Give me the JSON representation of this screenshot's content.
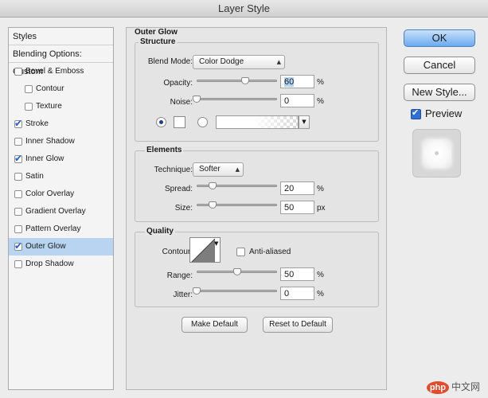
{
  "window": {
    "title": "Layer Style"
  },
  "sidebar": {
    "header": "Styles",
    "blending": "Blending Options: Custom",
    "items": [
      {
        "label": "Bevel & Emboss",
        "checked": false,
        "indent": false,
        "selected": false
      },
      {
        "label": "Contour",
        "checked": false,
        "indent": true,
        "selected": false
      },
      {
        "label": "Texture",
        "checked": false,
        "indent": true,
        "selected": false
      },
      {
        "label": "Stroke",
        "checked": true,
        "indent": false,
        "selected": false
      },
      {
        "label": "Inner Shadow",
        "checked": false,
        "indent": false,
        "selected": false
      },
      {
        "label": "Inner Glow",
        "checked": true,
        "indent": false,
        "selected": false
      },
      {
        "label": "Satin",
        "checked": false,
        "indent": false,
        "selected": false
      },
      {
        "label": "Color Overlay",
        "checked": false,
        "indent": false,
        "selected": false
      },
      {
        "label": "Gradient Overlay",
        "checked": false,
        "indent": false,
        "selected": false
      },
      {
        "label": "Pattern Overlay",
        "checked": false,
        "indent": false,
        "selected": false
      },
      {
        "label": "Outer Glow",
        "checked": true,
        "indent": false,
        "selected": true
      },
      {
        "label": "Drop Shadow",
        "checked": false,
        "indent": false,
        "selected": false
      }
    ]
  },
  "panel": {
    "title": "Outer Glow",
    "structure": {
      "title": "Structure",
      "blend_mode_label": "Blend Mode:",
      "blend_mode_value": "Color Dodge",
      "opacity_label": "Opacity:",
      "opacity_value": "60",
      "opacity_pct": 60,
      "noise_label": "Noise:",
      "noise_value": "0",
      "noise_pct": 0,
      "unit": "%"
    },
    "elements": {
      "title": "Elements",
      "technique_label": "Technique:",
      "technique_value": "Softer",
      "spread_label": "Spread:",
      "spread_value": "20",
      "spread_pct": 20,
      "size_label": "Size:",
      "size_value": "50",
      "size_pct": 20,
      "spread_unit": "%",
      "size_unit": "px"
    },
    "quality": {
      "title": "Quality",
      "contour_label": "Contour:",
      "anti_aliased_label": "Anti-aliased",
      "range_label": "Range:",
      "range_value": "50",
      "range_pct": 50,
      "jitter_label": "Jitter:",
      "jitter_value": "0",
      "jitter_pct": 0,
      "unit": "%"
    },
    "make_default": "Make Default",
    "reset_default": "Reset to Default"
  },
  "buttons": {
    "ok": "OK",
    "cancel": "Cancel",
    "new_style": "New Style...",
    "preview": "Preview"
  },
  "watermark": {
    "php": "php",
    "cn": "中文网"
  }
}
